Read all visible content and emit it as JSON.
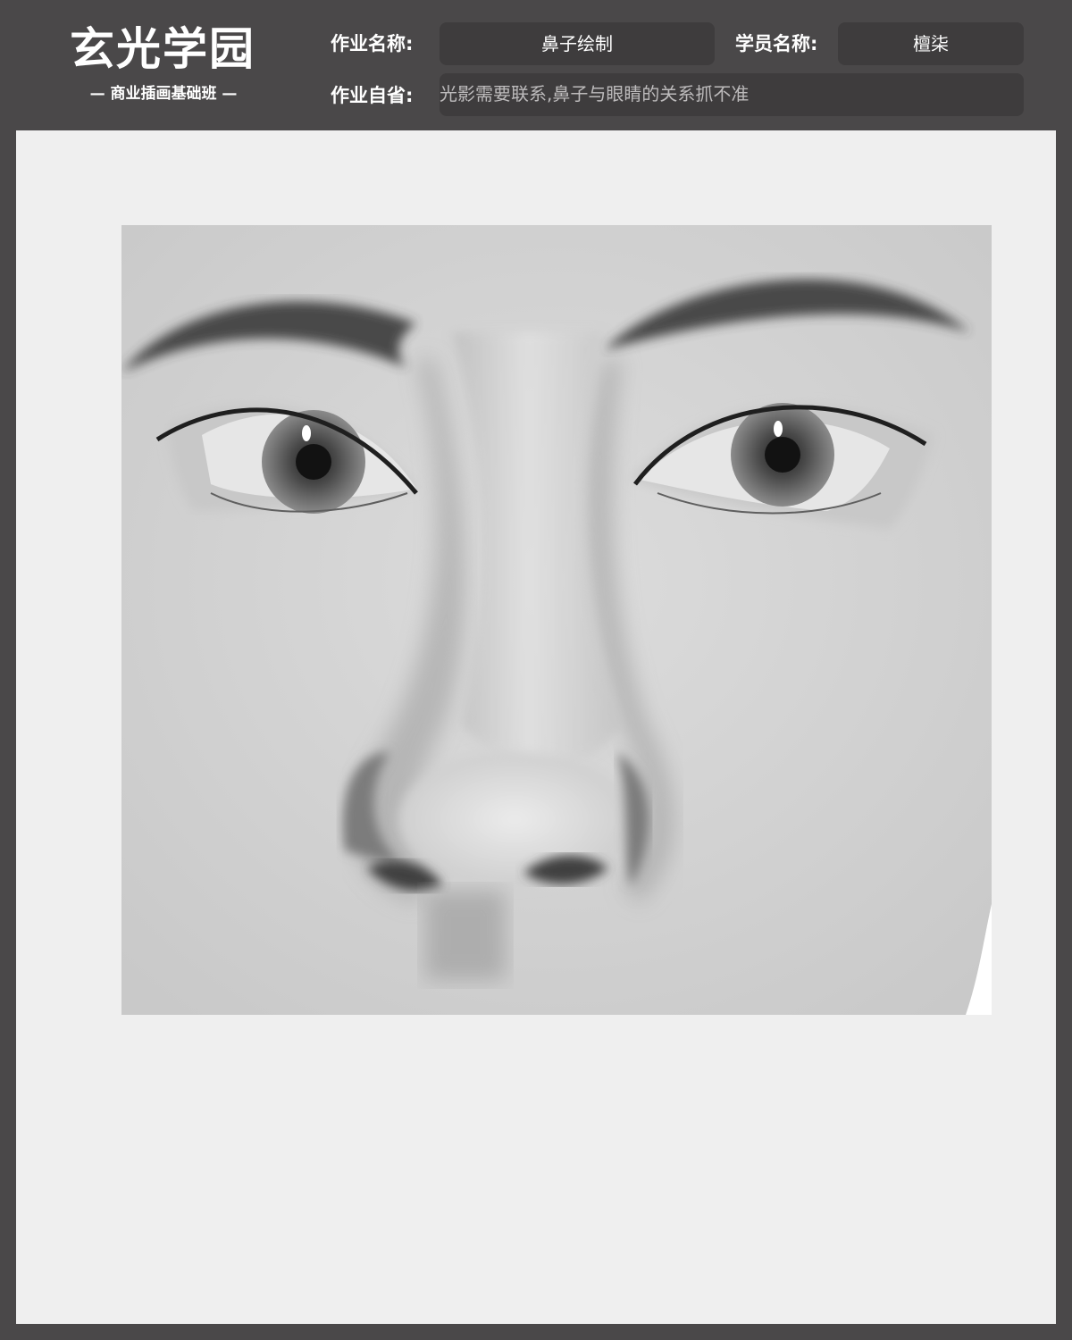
{
  "logo": {
    "title": "玄光学园",
    "subtitle": "— 商业插画基础班 —"
  },
  "assignment": {
    "name_label": "作业名称:",
    "name_value": "鼻子绘制",
    "student_label": "学员名称:",
    "student_value": "檀柒",
    "reflection_label": "作业自省:",
    "reflection_value": "光影需要联系,鼻子与眼睛的关系抓不准"
  },
  "colors": {
    "frame": "#4a4849",
    "field_bg": "#3e3c3d",
    "canvas_bg": "#efefef"
  }
}
